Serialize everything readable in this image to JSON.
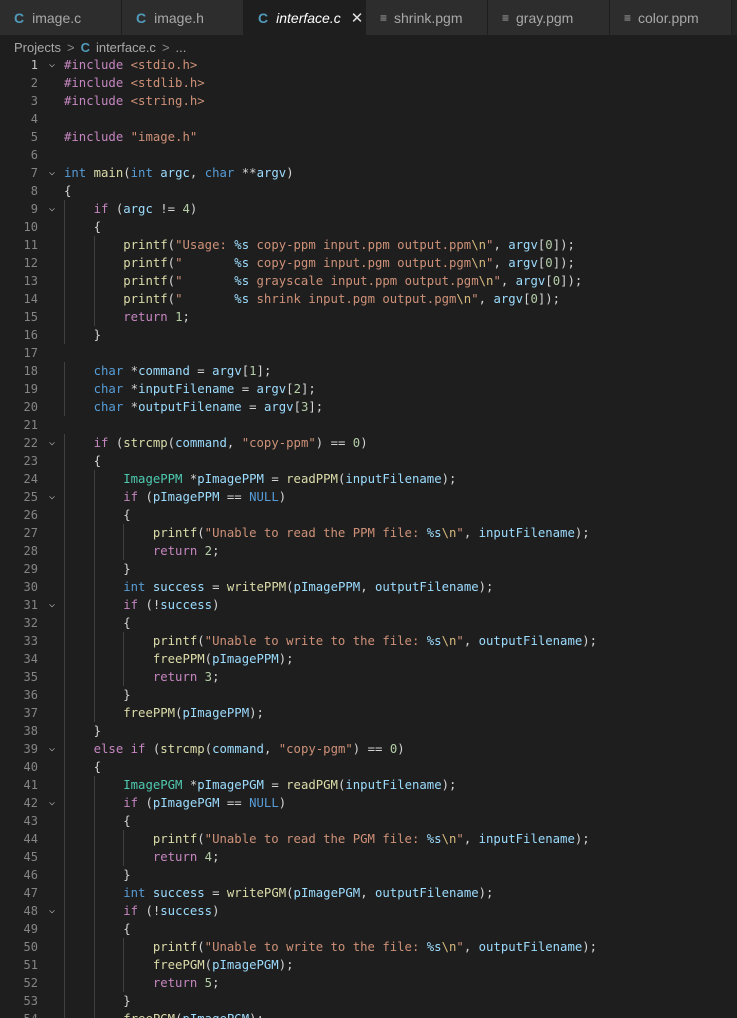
{
  "tabs": [
    {
      "label": "image.c",
      "icon": "C",
      "kind": "c",
      "active": false
    },
    {
      "label": "image.h",
      "icon": "C",
      "kind": "c",
      "active": false
    },
    {
      "label": "interface.c",
      "icon": "C",
      "kind": "c",
      "active": true
    },
    {
      "label": "shrink.pgm",
      "icon": "≡",
      "kind": "file",
      "active": false
    },
    {
      "label": "gray.pgm",
      "icon": "≡",
      "kind": "file",
      "active": false
    },
    {
      "label": "color.ppm",
      "icon": "≡",
      "kind": "file",
      "active": false
    }
  ],
  "breadcrumb": {
    "root": "Projects",
    "file": "interface.c",
    "file_icon": "C",
    "sep": ">",
    "more": "..."
  },
  "colors": {
    "keyword": "#569cd6",
    "control": "#c586c0",
    "string": "#ce9178",
    "number": "#b5cea8",
    "function": "#dcdcaa",
    "variable": "#9cdcfe",
    "type": "#4ec9b0",
    "c_icon": "#519aba"
  },
  "current_line": 1,
  "fold_lines": [
    1,
    7,
    9,
    22,
    25,
    31,
    39,
    42,
    48
  ],
  "code_lines": [
    "#include <stdio.h>",
    "#include <stdlib.h>",
    "#include <string.h>",
    "",
    "#include \"image.h\"",
    "",
    "int main(int argc, char **argv)",
    "{",
    "    if (argc != 4)",
    "    {",
    "        printf(\"Usage: %s copy-ppm input.ppm output.ppm\\n\", argv[0]);",
    "        printf(\"       %s copy-pgm input.pgm output.pgm\\n\", argv[0]);",
    "        printf(\"       %s grayscale input.ppm output.pgm\\n\", argv[0]);",
    "        printf(\"       %s shrink input.pgm output.pgm\\n\", argv[0]);",
    "        return 1;",
    "    }",
    "",
    "    char *command = argv[1];",
    "    char *inputFilename = argv[2];",
    "    char *outputFilename = argv[3];",
    "",
    "    if (strcmp(command, \"copy-ppm\") == 0)",
    "    {",
    "        ImagePPM *pImagePPM = readPPM(inputFilename);",
    "        if (pImagePPM == NULL)",
    "        {",
    "            printf(\"Unable to read the PPM file: %s\\n\", inputFilename);",
    "            return 2;",
    "        }",
    "        int success = writePPM(pImagePPM, outputFilename);",
    "        if (!success)",
    "        {",
    "            printf(\"Unable to write to the file: %s\\n\", outputFilename);",
    "            freePPM(pImagePPM);",
    "            return 3;",
    "        }",
    "        freePPM(pImagePPM);",
    "    }",
    "    else if (strcmp(command, \"copy-pgm\") == 0)",
    "    {",
    "        ImagePGM *pImagePGM = readPGM(inputFilename);",
    "        if (pImagePGM == NULL)",
    "        {",
    "            printf(\"Unable to read the PGM file: %s\\n\", inputFilename);",
    "            return 4;",
    "        }",
    "        int success = writePGM(pImagePGM, outputFilename);",
    "        if (!success)",
    "        {",
    "            printf(\"Unable to write to the file: %s\\n\", outputFilename);",
    "            freePGM(pImagePGM);",
    "            return 5;",
    "        }",
    "        freePGM(pImagePGM);"
  ]
}
